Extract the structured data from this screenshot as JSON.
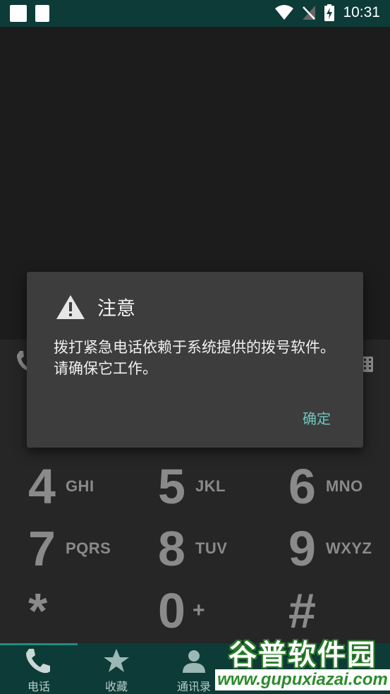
{
  "status_bar": {
    "time": "10:31"
  },
  "dialog": {
    "title": "注意",
    "message": "拨打紧急电话依赖于系统提供的拨号软件。请确保它工作。",
    "confirm_label": "确定"
  },
  "dialpad": {
    "rows": [
      [
        {
          "digit": "4",
          "letters": "GHI"
        },
        {
          "digit": "5",
          "letters": "JKL"
        },
        {
          "digit": "6",
          "letters": "MNO"
        }
      ],
      [
        {
          "digit": "7",
          "letters": "PQRS"
        },
        {
          "digit": "8",
          "letters": "TUV"
        },
        {
          "digit": "9",
          "letters": "WXYZ"
        }
      ],
      [
        {
          "digit": "*",
          "letters": ""
        },
        {
          "digit": "0",
          "letters": "+"
        },
        {
          "digit": "#",
          "letters": ""
        }
      ]
    ]
  },
  "bottom_nav": {
    "items": [
      {
        "label": "电话",
        "icon": "phone-icon"
      },
      {
        "label": "收藏",
        "icon": "star-icon"
      },
      {
        "label": "通讯录",
        "icon": "person-icon"
      }
    ]
  },
  "watermark": {
    "brand": "谷普软件园",
    "url": "www.gupuxiazai.com"
  },
  "colors": {
    "status_bar": "#0d3b37",
    "dialog_bg": "#3d3d3d",
    "accent": "#6fc6bd",
    "key_text": "#8a8a8a"
  }
}
